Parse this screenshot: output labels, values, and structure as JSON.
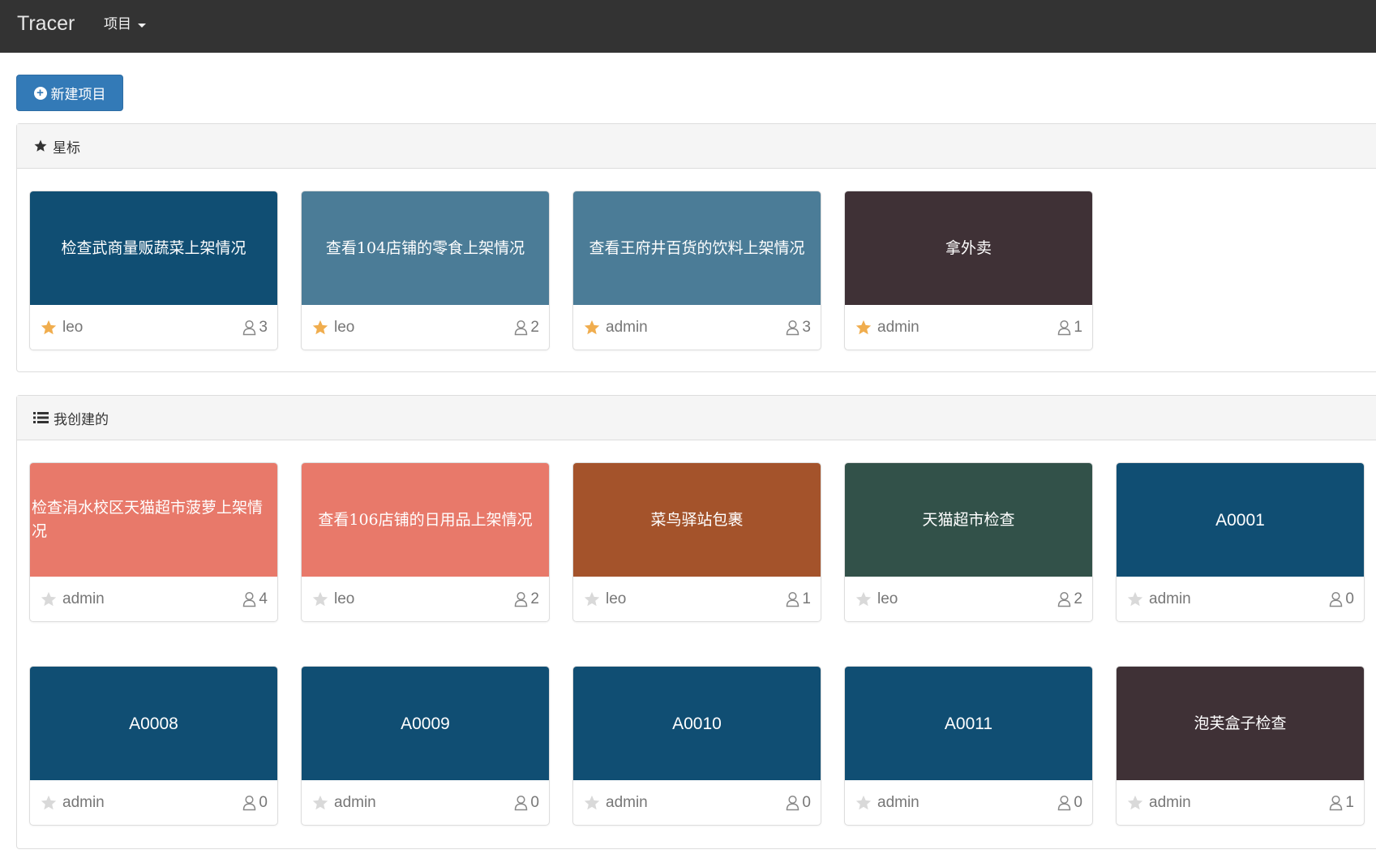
{
  "navbar": {
    "brand": "Tracer",
    "menu_label": "项目"
  },
  "actions": {
    "new_project": "新建项目"
  },
  "colors": {
    "navbar_bg": "#333333",
    "primary": "#337ab7",
    "star_active": "#f0ad4e",
    "star_inactive": "#d9d9d9"
  },
  "starred": {
    "heading": "星标",
    "cards": [
      {
        "title": "检查武商量贩蔬菜上架情况",
        "owner": "leo",
        "members": "3",
        "color": "#104e73",
        "starred": true
      },
      {
        "title": "查看104店铺的零食上架情况",
        "owner": "leo",
        "members": "2",
        "color": "#4b7c97",
        "starred": true
      },
      {
        "title": "查看王府井百货的饮料上架情况",
        "owner": "admin",
        "members": "3",
        "color": "#4b7c97",
        "starred": true
      },
      {
        "title": "拿外卖",
        "owner": "admin",
        "members": "1",
        "color": "#3f3136",
        "starred": true
      }
    ]
  },
  "created": {
    "heading": "我创建的",
    "cards": [
      {
        "title": "检查涓水校区天猫超市菠萝上架情况",
        "owner": "admin",
        "members": "4",
        "color": "#e8796a",
        "starred": false
      },
      {
        "title": "查看106店铺的日用品上架情况",
        "owner": "leo",
        "members": "2",
        "color": "#e8796a",
        "starred": false
      },
      {
        "title": "菜鸟驿站包裹",
        "owner": "leo",
        "members": "1",
        "color": "#a4532b",
        "starred": false
      },
      {
        "title": "天猫超市检查",
        "owner": "leo",
        "members": "2",
        "color": "#325149",
        "starred": false
      },
      {
        "title": "A0001",
        "owner": "admin",
        "members": "0",
        "color": "#104e73",
        "starred": false
      },
      {
        "title": "A0008",
        "owner": "admin",
        "members": "0",
        "color": "#104e73",
        "starred": false
      },
      {
        "title": "A0009",
        "owner": "admin",
        "members": "0",
        "color": "#104e73",
        "starred": false
      },
      {
        "title": "A0010",
        "owner": "admin",
        "members": "0",
        "color": "#104e73",
        "starred": false
      },
      {
        "title": "A0011",
        "owner": "admin",
        "members": "0",
        "color": "#104e73",
        "starred": false
      },
      {
        "title": "泡芙盒子检查",
        "owner": "admin",
        "members": "1",
        "color": "#3f3136",
        "starred": false
      }
    ]
  }
}
